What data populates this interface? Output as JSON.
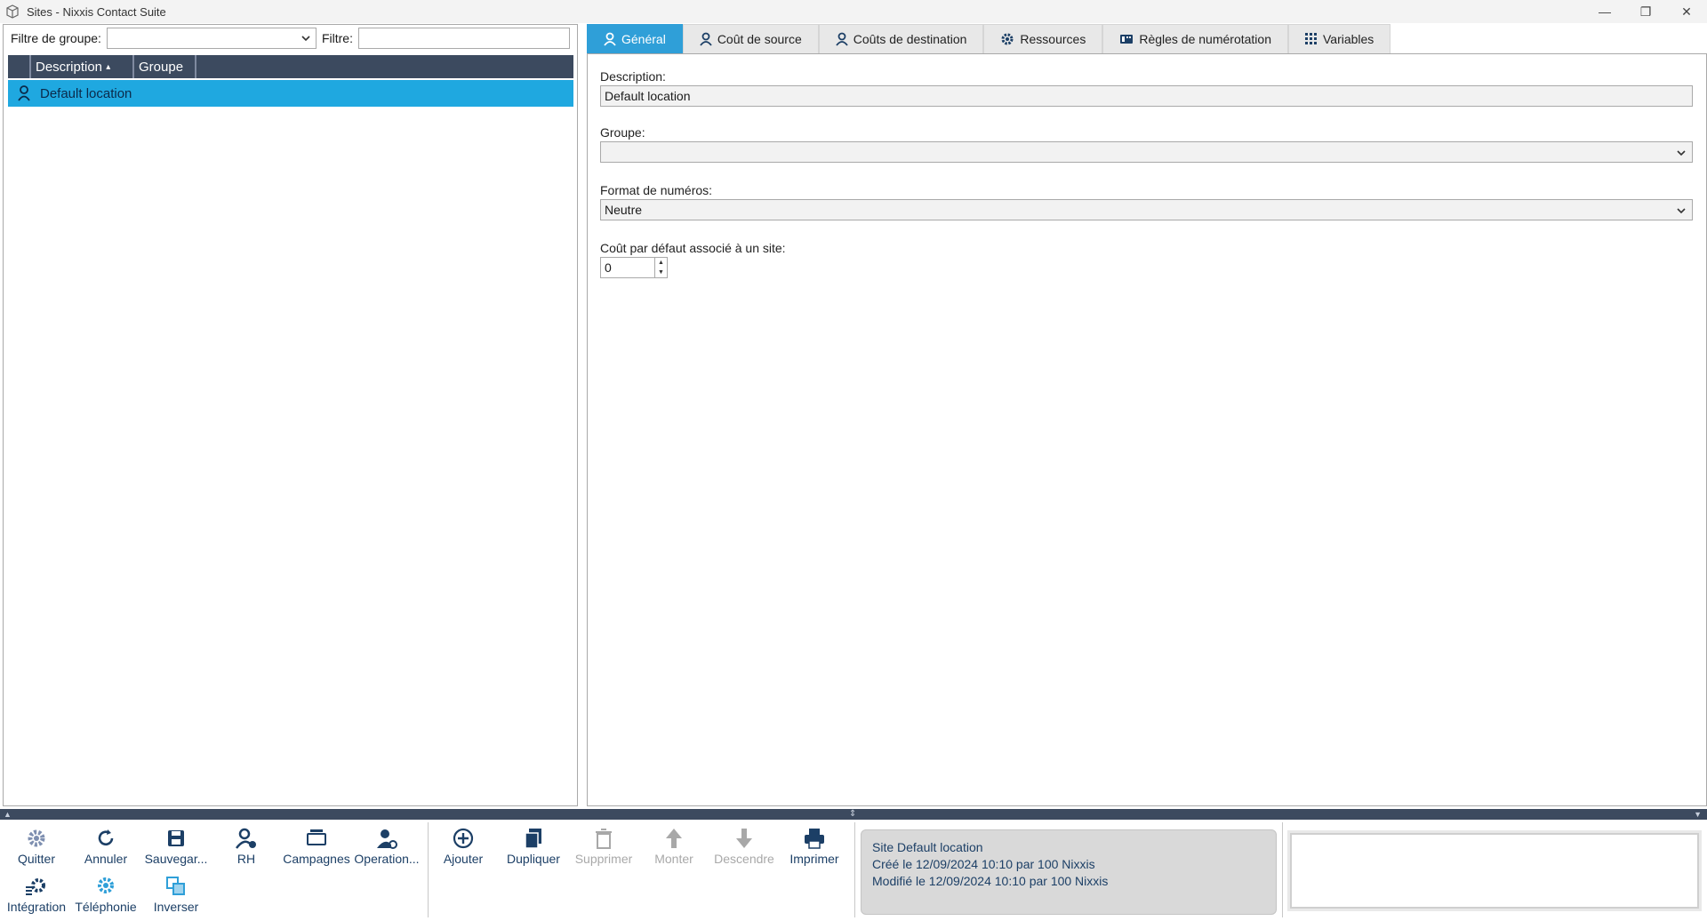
{
  "window": {
    "title": "Sites - Nixxis Contact Suite"
  },
  "filters": {
    "group_label": "Filtre de groupe:",
    "group_value": "",
    "text_label": "Filtre:",
    "text_value": ""
  },
  "grid": {
    "columns": [
      "Description",
      "Groupe"
    ],
    "sort_indicator": "▴",
    "rows": [
      {
        "description": "Default location",
        "group": ""
      }
    ]
  },
  "tabs": [
    {
      "label": "Général",
      "icon": "user-icon",
      "active": true
    },
    {
      "label": "Coût de source",
      "icon": "user-icon",
      "active": false
    },
    {
      "label": "Coûts de destination",
      "icon": "user-icon",
      "active": false
    },
    {
      "label": "Ressources",
      "icon": "gear-icon",
      "active": false
    },
    {
      "label": "Règles de numérotation",
      "icon": "dial-icon",
      "active": false
    },
    {
      "label": "Variables",
      "icon": "grid-icon",
      "active": false
    }
  ],
  "general": {
    "description_label": "Description:",
    "description_value": "Default location",
    "group_label": "Groupe:",
    "group_value": "",
    "format_label": "Format de numéros:",
    "format_value": "Neutre",
    "cost_label": "Coût par défaut associé à un site:",
    "cost_value": "0"
  },
  "toolbar": {
    "quit": "Quitter",
    "cancel": "Annuler",
    "save": "Sauvegar...",
    "hr": "RH",
    "campaigns": "Campagnes",
    "operations": "Operation...",
    "integration": "Intégration",
    "telephony": "Téléphonie",
    "invert": "Inverser",
    "add": "Ajouter",
    "duplicate": "Dupliquer",
    "delete": "Supprimer",
    "up": "Monter",
    "down": "Descendre",
    "print": "Imprimer"
  },
  "info": {
    "line1": "Site Default location",
    "line2": "Créé le 12/09/2024 10:10 par 100 Nixxis",
    "line3": "Modifié le 12/09/2024 10:10 par 100 Nixxis"
  },
  "colors": {
    "accent": "#2f9fd8",
    "selection": "#1fa8e0",
    "header": "#3c4a5f",
    "icon": "#1c3f66"
  }
}
